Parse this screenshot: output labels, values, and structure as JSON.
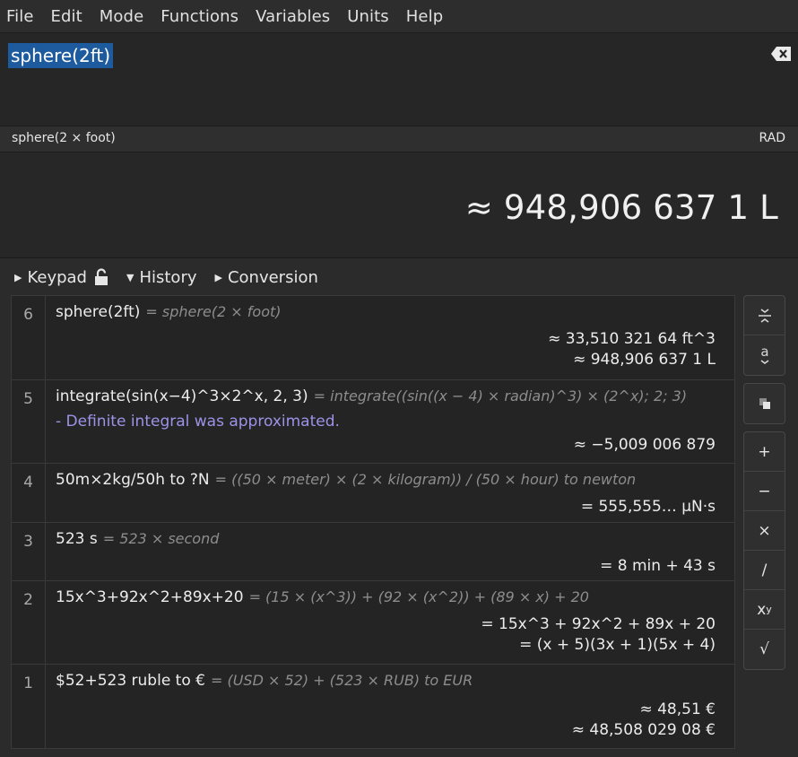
{
  "menu": [
    "File",
    "Edit",
    "Mode",
    "Functions",
    "Variables",
    "Units",
    "Help"
  ],
  "expression": "sphere(2ft)",
  "status": {
    "parsed": "sphere(2 × foot)",
    "angle_mode": "RAD"
  },
  "result": "≈ 948,906 637 1 L",
  "tabs": {
    "keypad": "Keypad",
    "history": "History",
    "conversion": "Conversion"
  },
  "history": [
    {
      "num": "6",
      "input": "sphere(2ft)",
      "parsed": "= sphere(2 × foot)",
      "answers": [
        "≈ 33,510 321 64 ft^3",
        "≈ 948,906 637 1 L"
      ]
    },
    {
      "num": "5",
      "input": "integrate(sin(x−4)^3×2^x, 2, 3)",
      "parsed": "= integrate((sin((x − 4) × radian)^3) × (2^x); 2; 3)",
      "warning": "- Definite integral was approximated.",
      "answers": [
        "≈ −5,009 006 879"
      ]
    },
    {
      "num": "4",
      "input": "50m×2kg/50h to ?N",
      "parsed": "= ((50 × meter) × (2 × kilogram)) / (50 × hour) to newton",
      "answers": [
        "= 555,555… µN·s"
      ]
    },
    {
      "num": "3",
      "input": "523 s",
      "parsed": "= 523 × second",
      "answers": [
        "= 8 min + 43 s"
      ]
    },
    {
      "num": "2",
      "input": "15x^3+92x^2+89x+20",
      "parsed": "= (15 × (x^3)) + (92 × (x^2)) + (89 × x) + 20",
      "answers": [
        "= 15x^3 + 92x^2 + 89x + 20",
        "= (x + 5)(3x + 1)(5x + 4)"
      ]
    },
    {
      "num": "1",
      "input": "$52+523 ruble to €",
      "parsed": "= (USD × 52) + (523 × RUB) to EUR",
      "answers": [
        "≈ 48,51 €",
        "≈ 48,508 029 08 €"
      ]
    }
  ],
  "side_buttons": {
    "add": "+",
    "subtract": "−",
    "multiply": "×",
    "divide": "/",
    "power_base": "x",
    "power_exp": "y",
    "sqrt": "√"
  }
}
